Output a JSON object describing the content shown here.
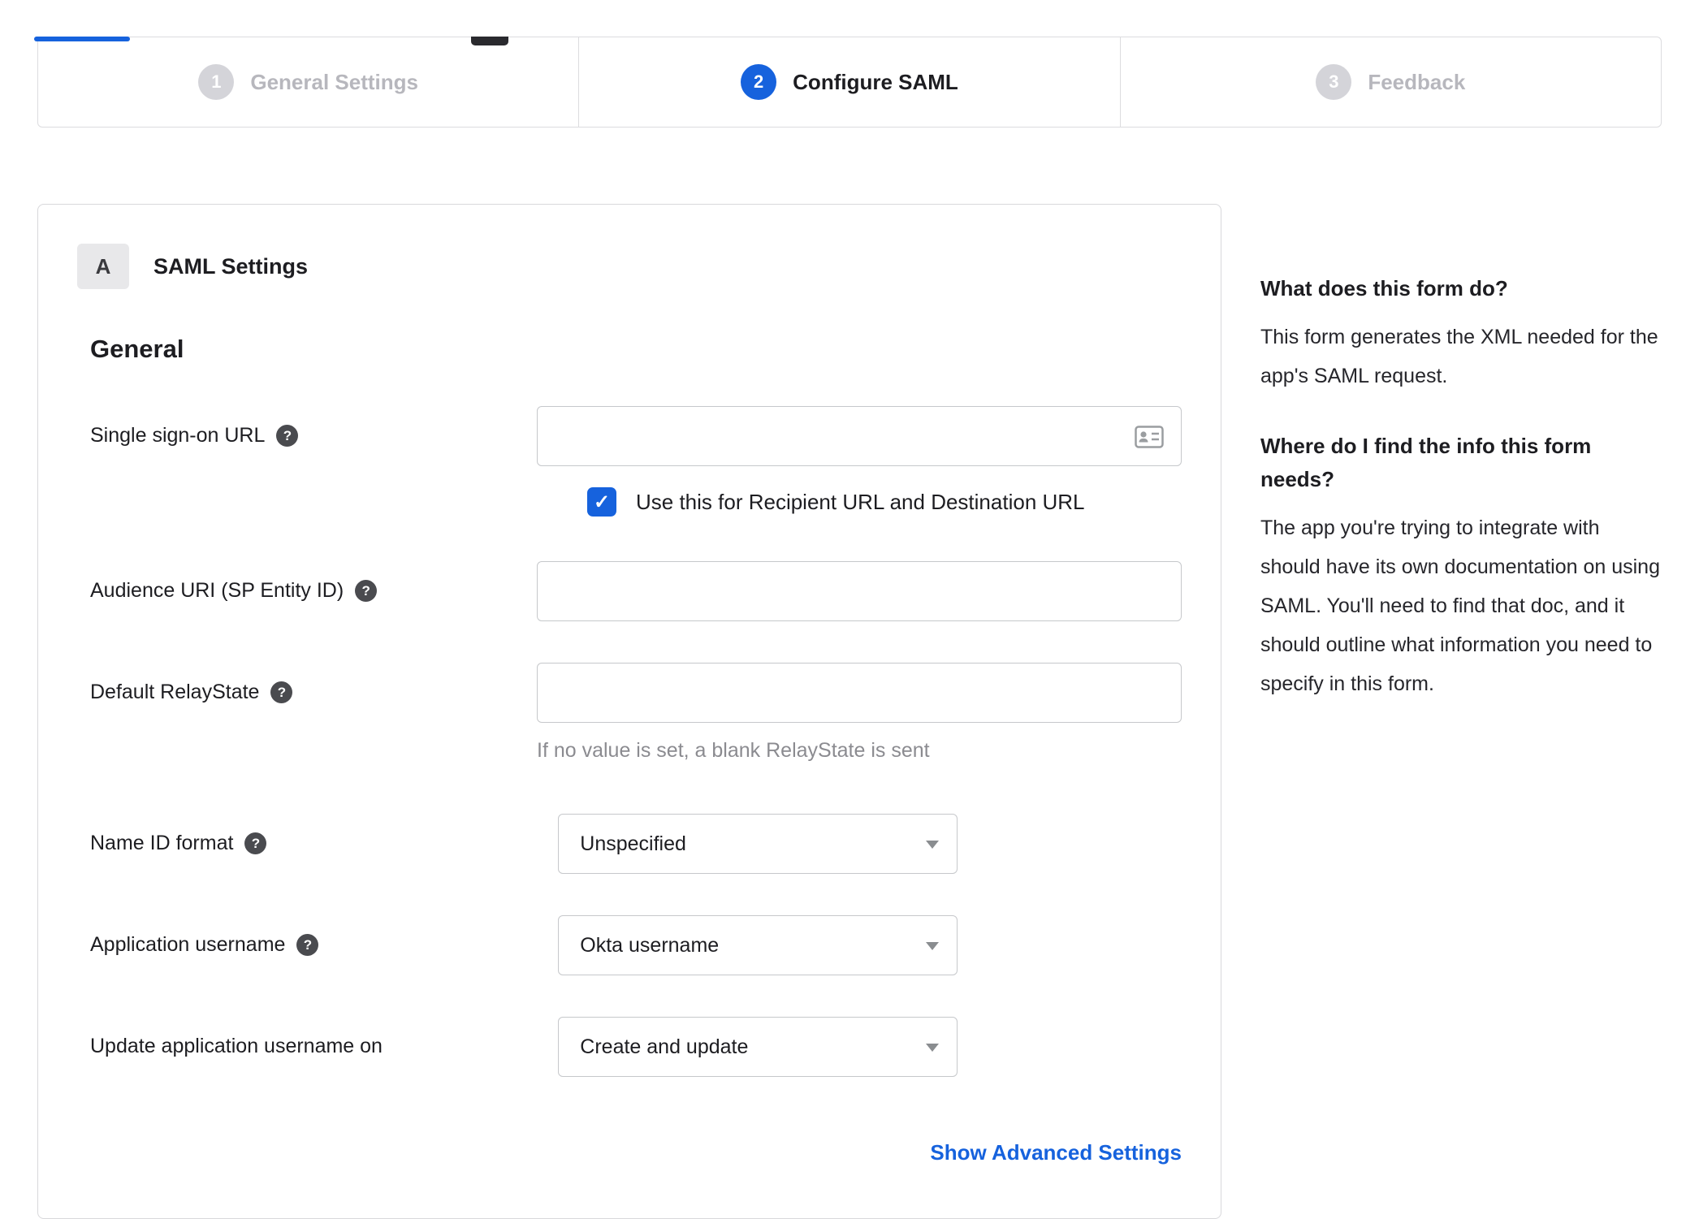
{
  "colors": {
    "accent_blue": "#1662dd",
    "inactive_gray": "#d4d4d9",
    "border_gray": "#d8d8db",
    "hint_gray": "#8b8b90"
  },
  "icons": {
    "help": "?",
    "checkmark": "✓",
    "address_card": "address-card",
    "dropdown_arrow": "caret-down"
  },
  "stepper": {
    "steps": [
      {
        "number": "1",
        "label": "General Settings",
        "state": "inactive"
      },
      {
        "number": "2",
        "label": "Configure SAML",
        "state": "active"
      },
      {
        "number": "3",
        "label": "Feedback",
        "state": "inactive"
      }
    ]
  },
  "panel": {
    "section_badge": "A",
    "section_title": "SAML Settings",
    "group_title": "General",
    "fields": {
      "sso_url": {
        "label": "Single sign-on URL",
        "value": ""
      },
      "sso_checkbox": {
        "label": "Use this for Recipient URL and Destination URL",
        "checked": true
      },
      "audience_uri": {
        "label": "Audience URI (SP Entity ID)",
        "value": ""
      },
      "relay_state": {
        "label": "Default RelayState",
        "value": "",
        "hint": "If no value is set, a blank RelayState is sent"
      },
      "name_id_format": {
        "label": "Name ID format",
        "value": "Unspecified"
      },
      "app_username": {
        "label": "Application username",
        "value": "Okta username"
      },
      "update_username": {
        "label": "Update application username on",
        "value": "Create and update"
      }
    },
    "advanced_link": "Show Advanced Settings"
  },
  "sidebar": {
    "sections": [
      {
        "heading": "What does this form do?",
        "body": "This form generates the XML needed for the app's SAML request."
      },
      {
        "heading": "Where do I find the info this form needs?",
        "body": "The app you're trying to integrate with should have its own documentation on using SAML. You'll need to find that doc, and it should outline what information you need to specify in this form."
      }
    ]
  }
}
